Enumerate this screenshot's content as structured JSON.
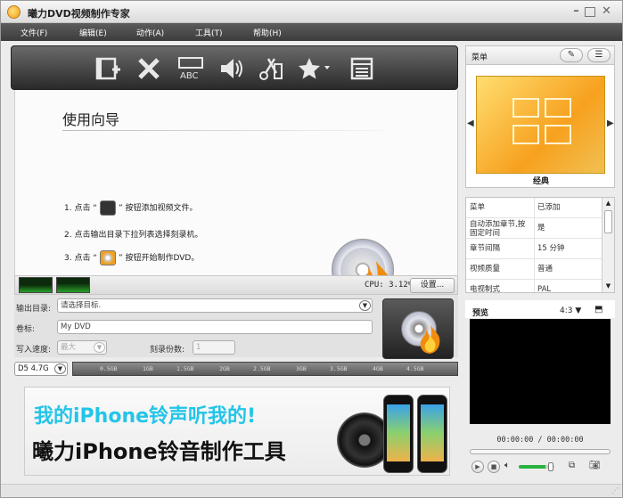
{
  "window": {
    "title": "曦力DVD视频制作专家"
  },
  "menu": [
    "文件(F)",
    "编辑(E)",
    "动作(A)",
    "工具(T)",
    "帮助(H)"
  ],
  "toolbar": {
    "icons": [
      "add-video-icon",
      "delete-icon",
      "subtitle-icon",
      "audio-icon",
      "trim-icon",
      "effect-icon",
      "chapter-icon"
    ],
    "subtitle_icon_text": "ABC"
  },
  "guide": {
    "title": "使用向导",
    "step1_pre": "1. 点击 “",
    "step1_post": "” 按钮添加视频文件。",
    "step2": "2. 点击输出目录下拉列表选择刻录机。",
    "step3_pre": "3. 点击 “",
    "step3_post": "” 按钮开始制作DVD。"
  },
  "cpu": {
    "label": "CPU: 3.12%",
    "settings_label": "设置..."
  },
  "output": {
    "dir_label": "输出目录:",
    "dir_value": "请选择目标.",
    "volume_label": "卷标:",
    "volume_value": "My DVD",
    "speed_label": "写入速度:",
    "speed_value": "最大",
    "copies_label": "刻录份数:",
    "copies_value": "1"
  },
  "disc": {
    "type": "D5 4.7G",
    "ticks": [
      "0.5GB",
      "1GB",
      "1.5GB",
      "2GB",
      "2.5GB",
      "3GB",
      "3.5GB",
      "4GB",
      "4.5GB"
    ]
  },
  "banner": {
    "line1": "我的iPhone铃声听我的!",
    "line2": "曦力iPhone铃音制作工具"
  },
  "menu_panel": {
    "title": "菜单",
    "template_name": "经典"
  },
  "props": [
    {
      "k": "菜单",
      "v": "已添加"
    },
    {
      "k": "自动添加章节,按固定时间",
      "v": "是"
    },
    {
      "k": "章节间隔",
      "v": "15 分钟"
    },
    {
      "k": "视频质量",
      "v": "普通"
    },
    {
      "k": "电视制式",
      "v": "PAL"
    }
  ],
  "preview": {
    "title": "预览",
    "ratio": "4:3",
    "time": "00:00:00 / 00:00:00",
    "volume_level": 0.75
  },
  "colors": {
    "accent_green": "#27b33d",
    "toolbar_dark": "#2a2a2a"
  }
}
